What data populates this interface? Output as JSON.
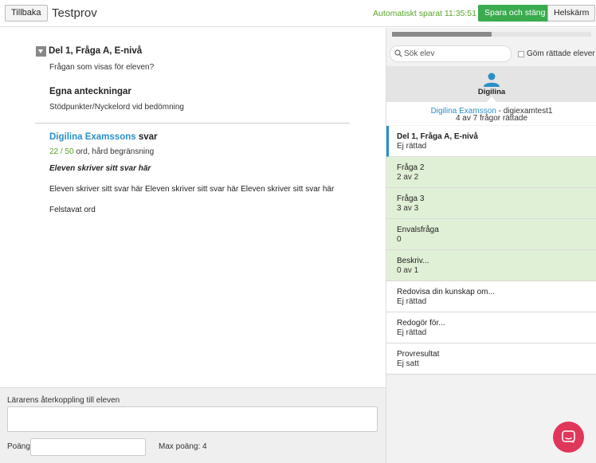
{
  "header": {
    "back_label": "Tillbaka",
    "title": "Testprov",
    "autosave": "Automatiskt sparat 11:35:51",
    "save_close_label": "Spara och stäng",
    "fullscreen_label": "Helskärm"
  },
  "question": {
    "title": "Del 1, Fråga A, E-nivå",
    "text": "Frågan som visas för eleven?"
  },
  "notes": {
    "heading": "Egna anteckningar",
    "text": "Stödpunkter/Nyckelord vid bedömning"
  },
  "answer": {
    "student_name": "Digilina Examssons",
    "suffix": " svar",
    "word_count": "22 / 50",
    "word_info": " ord, hård begränsning",
    "emphasis": "Eleven skriver sitt svar här",
    "body": "Eleven skriver sitt svar här Eleven skriver sitt svar här Eleven skriver sitt svar här",
    "typo": "Felstavat ord"
  },
  "feedback": {
    "label": "Lärarens återkoppling till eleven",
    "points_label": "Poäng",
    "max_points": "Max poäng: 4"
  },
  "sidebar": {
    "progress": 0.5,
    "search_placeholder": "Sök elev",
    "hide_graded_label": "Göm rättade elever",
    "student_first_name": "Digilina",
    "student_full_name": "Digilina Examsson",
    "student_user": " - digiexamtest1",
    "graded_summary": "4 av 7 frågor rättade",
    "questions": [
      {
        "title": "Del 1, Fråga A, E-nivå",
        "status": "Ej rättad"
      },
      {
        "title": "Fråga 2",
        "status": "2 av 2"
      },
      {
        "title": "Fråga 3",
        "status": "3 av 3"
      },
      {
        "title": "Envalsfråga",
        "status": "0"
      },
      {
        "title": "Beskriv...",
        "status": "0 av 1"
      },
      {
        "title": "Redovisa din kunskap om...",
        "status": "Ej rättad"
      },
      {
        "title": "Redogör för...",
        "status": "Ej rättad"
      },
      {
        "title": "Provresultat",
        "status": "Ej satt"
      }
    ]
  },
  "colors": {
    "accent_blue": "#2a8fc7",
    "save_green": "#3aab4e",
    "graded_bg": "#e0f0d6",
    "chat_red": "#e0365a"
  }
}
